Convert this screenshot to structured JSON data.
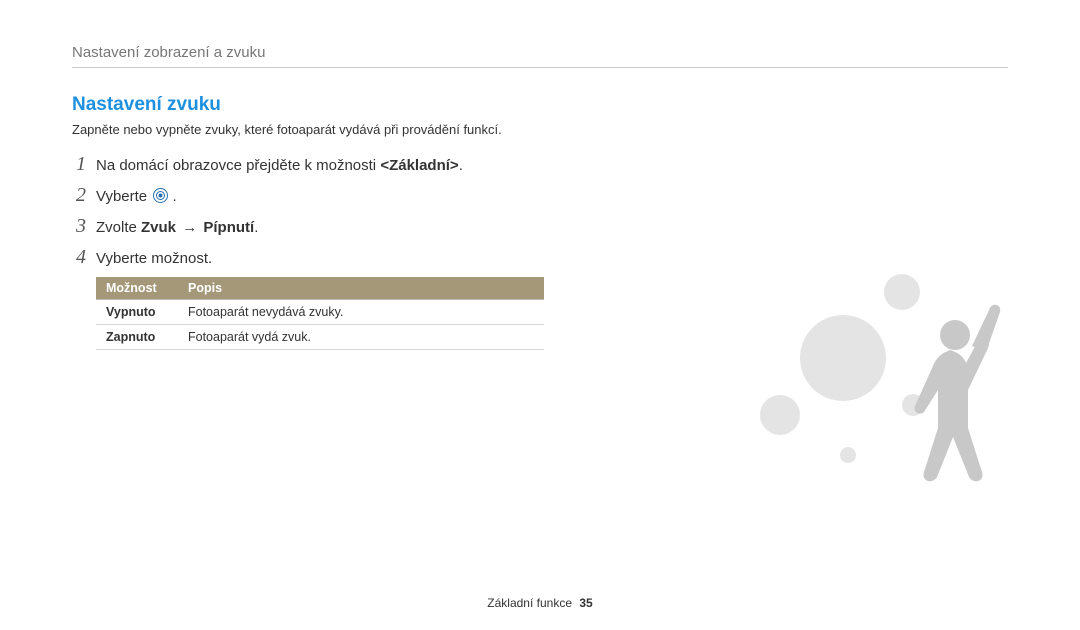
{
  "header": {
    "title": "Nastavení zobrazení a zvuku"
  },
  "section": {
    "heading": "Nastavení zvuku",
    "description": "Zapněte nebo vypněte zvuky, které fotoaparát vydává při provádění funkcí."
  },
  "steps": {
    "s1": {
      "num": "1",
      "pre": "Na domácí obrazovce přejděte k možnosti ",
      "bold": "<Základní>",
      "post": "."
    },
    "s2": {
      "num": "2",
      "pre": "Vyberte ",
      "post": " ."
    },
    "s3": {
      "num": "3",
      "pre": "Zvolte ",
      "b1": "Zvuk",
      "arrow": " → ",
      "b2": "Pípnutí",
      "post": "."
    },
    "s4": {
      "num": "4",
      "text": "Vyberte možnost."
    }
  },
  "table": {
    "h1": "Možnost",
    "h2": "Popis",
    "rows": [
      {
        "opt": "Vypnuto",
        "desc": "Fotoaparát nevydává zvuky."
      },
      {
        "opt": "Zapnuto",
        "desc": "Fotoaparát vydá zvuk."
      }
    ]
  },
  "footer": {
    "section": "Základní funkce",
    "page": "35"
  },
  "icon_name": "settings-target-icon"
}
